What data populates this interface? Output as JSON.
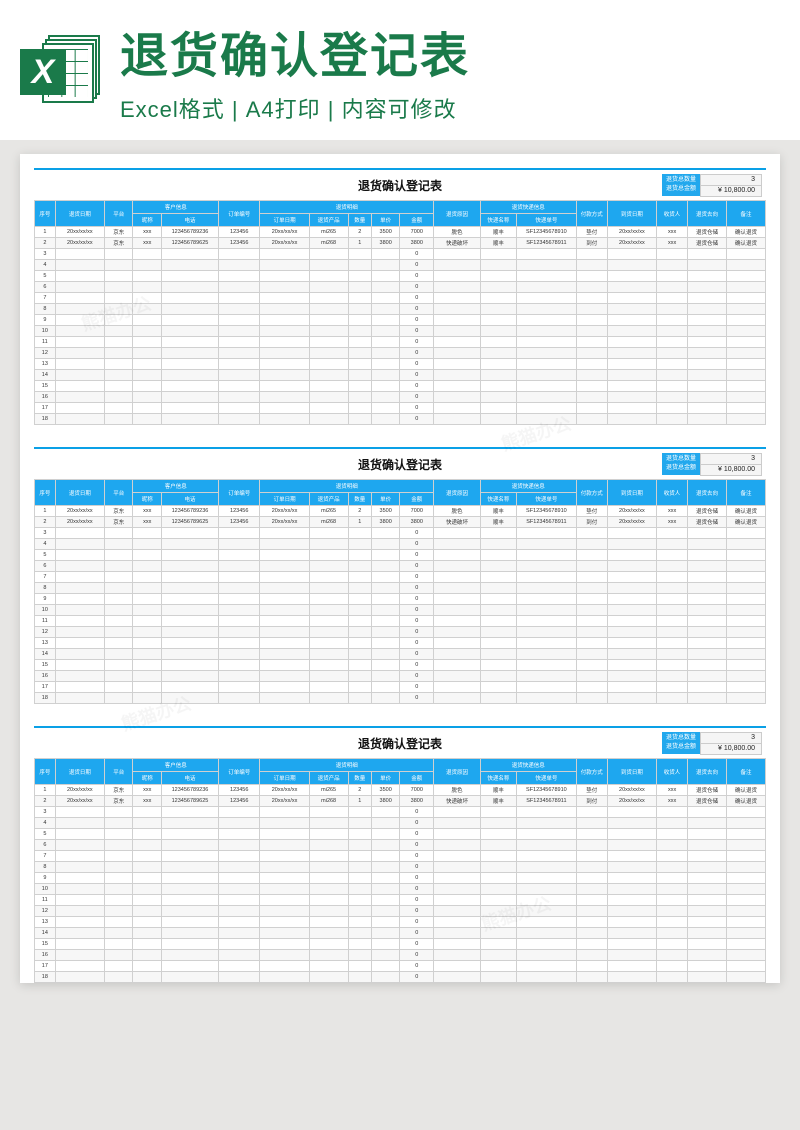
{
  "banner": {
    "title": "退货确认登记表",
    "subtitle": "Excel格式 | A4打印 | 内容可修改",
    "icon_letter": "X"
  },
  "sheet": {
    "title": "退货确认登记表",
    "summary_label1": "退货总数量",
    "summary_label2": "退货总金额",
    "summary_val1": "3",
    "summary_val2": "¥   10,800.00",
    "group_customer": "客户信息",
    "group_return": "退货明细",
    "group_express": "退货快递信息",
    "headers": {
      "seq": "序号",
      "return_date": "退货日期",
      "platform": "平台",
      "nickname": "昵称",
      "phone": "电话",
      "order_no": "订单编号",
      "order_date": "订单日期",
      "product": "退货产品",
      "qty": "数量",
      "price": "单价",
      "amount": "金额",
      "reason": "退货原因",
      "courier": "快递名称",
      "tracking": "快递单号",
      "pay_method": "付款方式",
      "arrive_date": "到货日期",
      "checker": "收货人",
      "disposition": "退货去向",
      "remark": "备注"
    },
    "rows": [
      {
        "seq": "1",
        "return_date": "20xx/xx/xx",
        "platform": "京东",
        "nickname": "xxx",
        "phone": "123456789236",
        "order_no": "123456",
        "order_date": "20xx/xx/xx",
        "product": "mi265",
        "qty": "2",
        "price": "3500",
        "amount": "7000",
        "reason": "脱色",
        "courier": "顺丰",
        "tracking": "SF12345678910",
        "pay_method": "垫付",
        "arrive_date": "20xx/xx/xx",
        "checker": "xxx",
        "disposition": "退货仓储",
        "remark": "确认退货"
      },
      {
        "seq": "2",
        "return_date": "20xx/xx/xx",
        "platform": "京东",
        "nickname": "xxx",
        "phone": "123456789625",
        "order_no": "123456",
        "order_date": "20xx/xx/xx",
        "product": "mi268",
        "qty": "1",
        "price": "3800",
        "amount": "3800",
        "reason": "快递破坏",
        "courier": "顺丰",
        "tracking": "SF12345678911",
        "pay_method": "到付",
        "arrive_date": "20xx/xx/xx",
        "checker": "xxx",
        "disposition": "退货仓储",
        "remark": "确认退货"
      },
      {
        "seq": "3",
        "amount": "0"
      },
      {
        "seq": "4",
        "amount": "0"
      },
      {
        "seq": "5",
        "amount": "0"
      },
      {
        "seq": "6",
        "amount": "0"
      },
      {
        "seq": "7",
        "amount": "0"
      },
      {
        "seq": "8",
        "amount": "0"
      },
      {
        "seq": "9",
        "amount": "0"
      },
      {
        "seq": "10",
        "amount": "0"
      },
      {
        "seq": "11",
        "amount": "0"
      },
      {
        "seq": "12",
        "amount": "0"
      },
      {
        "seq": "13",
        "amount": "0"
      },
      {
        "seq": "14",
        "amount": "0"
      },
      {
        "seq": "15",
        "amount": "0"
      },
      {
        "seq": "16",
        "amount": "0"
      },
      {
        "seq": "17",
        "amount": "0"
      },
      {
        "seq": "18",
        "amount": "0"
      }
    ]
  },
  "chart_data": {
    "type": "table",
    "title": "退货确认登记表",
    "columns": [
      "序号",
      "退货日期",
      "平台",
      "昵称",
      "电话",
      "订单编号",
      "订单日期",
      "退货产品",
      "数量",
      "单价",
      "金额",
      "退货原因",
      "快递名称",
      "快递单号",
      "付款方式",
      "到货日期",
      "收货人",
      "退货去向",
      "备注"
    ],
    "summary": {
      "退货总数量": 3,
      "退货总金额": 10800.0
    },
    "rows": [
      [
        1,
        "20xx/xx/xx",
        "京东",
        "xxx",
        "123456789236",
        "123456",
        "20xx/xx/xx",
        "mi265",
        2,
        3500,
        7000,
        "脱色",
        "顺丰",
        "SF12345678910",
        "垫付",
        "20xx/xx/xx",
        "xxx",
        "退货仓储",
        "确认退货"
      ],
      [
        2,
        "20xx/xx/xx",
        "京东",
        "xxx",
        "123456789625",
        "123456",
        "20xx/xx/xx",
        "mi268",
        1,
        3800,
        3800,
        "快递破坏",
        "顺丰",
        "SF12345678911",
        "到付",
        "20xx/xx/xx",
        "xxx",
        "退货仓储",
        "确认退货"
      ]
    ]
  }
}
